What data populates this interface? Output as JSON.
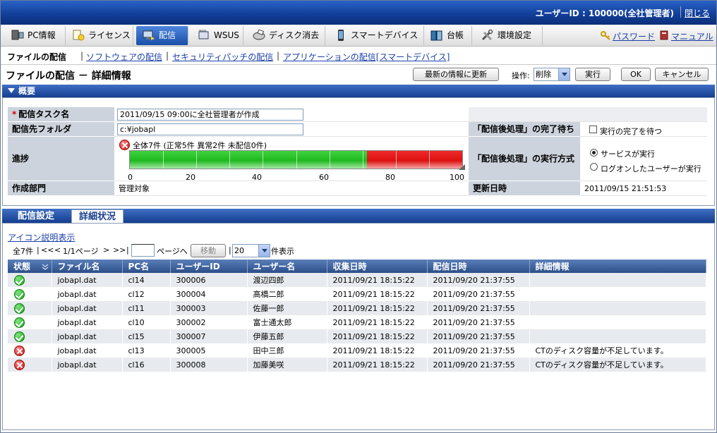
{
  "header": {
    "user_id": "ユーザーID : 100000(全社管理者)",
    "close_label": "閉じる"
  },
  "menu": [
    {
      "label": "PC情報",
      "icon": "pc-icon"
    },
    {
      "label": "ライセンス",
      "icon": "license-icon"
    },
    {
      "label": "配信",
      "icon": "distribution-icon",
      "active": true
    },
    {
      "label": "WSUS",
      "icon": "wsus-icon"
    },
    {
      "label": "ディスク消去",
      "icon": "disk-erase-icon"
    },
    {
      "label": "スマートデバイス",
      "icon": "smart-device-icon"
    },
    {
      "label": "台帳",
      "icon": "ledger-icon"
    },
    {
      "label": "環境設定",
      "icon": "settings-tool-icon"
    }
  ],
  "right_links": {
    "password": "パスワード",
    "manual": "マニュアル"
  },
  "subnav": {
    "current": "ファイルの配信",
    "links": [
      "ソフトウェアの配信",
      "セキュリティパッチの配信",
      "アプリケーションの配信[スマートデバイス]"
    ]
  },
  "page": {
    "title": "ファイルの配信 － 詳細情報",
    "refresh_button": "最新の情報に更新",
    "operation_label": "操作:",
    "operation_value": "削除",
    "execute_button": "実行",
    "ok_button": "OK",
    "cancel_button": "キャンセル"
  },
  "summary": {
    "section_title": "概要",
    "task_name_label": "配信タスク名",
    "task_name_value": "2011/09/15 09:00に全社管理者が作成",
    "folder_label": "配信先フォルダ",
    "folder_value": "c:¥jobapl",
    "progress_label": "進捗",
    "progress_text": "全体7件 (正常5件 異常2件 未配信0件)",
    "progress": {
      "total": 7,
      "ok": 5,
      "error": 2,
      "undelivered": 0
    },
    "ticks": [
      "0",
      "20",
      "40",
      "60",
      "80",
      "100"
    ],
    "dept_label": "作成部門",
    "dept_value": "管理対象",
    "wait_label": "「配信後処理」の完了待ち",
    "wait_option": "実行の完了を待つ",
    "method_label": "「配信後処理」の実行方式",
    "method_options": [
      "サービスが実行",
      "ログオンしたユーザーが実行"
    ],
    "method_selected": 0,
    "updated_label": "更新日時",
    "updated_value": "2011/09/15 21:51:53"
  },
  "tabs": {
    "settings": "配信設定",
    "detail": "詳細状況"
  },
  "detail": {
    "icon_legend": "アイコン説明表示",
    "pager": {
      "total": "全7件",
      "first": "<<",
      "prev": "<",
      "page_info": "1/1ページ",
      "next": ">",
      "last": ">>",
      "goto_label": "ページへ",
      "move_button": "移動",
      "per_page": "20",
      "per_page_label": "件表示"
    },
    "columns": [
      "状態",
      "ファイル名",
      "PC名",
      "ユーザーID",
      "ユーザー名",
      "収集日時",
      "配信日時",
      "詳細情報"
    ],
    "rows": [
      {
        "status": "ok",
        "file": "jobapl.dat",
        "pc": "cl14",
        "uid": "300006",
        "uname": "渡辺四郎",
        "collected": "2011/09/21 18:15:22",
        "delivered": "2011/09/20 21:37:55",
        "detail": ""
      },
      {
        "status": "ok",
        "file": "jobapl.dat",
        "pc": "cl12",
        "uid": "300004",
        "uname": "高橋二郎",
        "collected": "2011/09/21 18:15:22",
        "delivered": "2011/09/20 21:37:55",
        "detail": ""
      },
      {
        "status": "ok",
        "file": "jobapl.dat",
        "pc": "cl11",
        "uid": "300003",
        "uname": "佐藤一郎",
        "collected": "2011/09/21 18:15:22",
        "delivered": "2011/09/20 21:37:55",
        "detail": ""
      },
      {
        "status": "ok",
        "file": "jobapl.dat",
        "pc": "cl10",
        "uid": "300002",
        "uname": "富士通太郎",
        "collected": "2011/09/21 18:15:22",
        "delivered": "2011/09/20 21:37:55",
        "detail": ""
      },
      {
        "status": "ok",
        "file": "jobapl.dat",
        "pc": "cl15",
        "uid": "300007",
        "uname": "伊藤五郎",
        "collected": "2011/09/21 18:15:22",
        "delivered": "2011/09/20 21:37:55",
        "detail": ""
      },
      {
        "status": "error",
        "file": "jobapl.dat",
        "pc": "cl13",
        "uid": "300005",
        "uname": "田中三郎",
        "collected": "2011/09/21 18:15:22",
        "delivered": "2011/09/20 21:37:55",
        "detail": "CTのディスク容量が不足しています。"
      },
      {
        "status": "error",
        "file": "jobapl.dat",
        "pc": "cl16",
        "uid": "300008",
        "uname": "加藤美咲",
        "collected": "2011/09/21 18:15:22",
        "delivered": "2011/09/20 21:37:55",
        "detail": "CTのディスク容量が不足しています。"
      }
    ]
  },
  "colors": {
    "header_blue": "#123f9a",
    "ok_green": "#1fb91f",
    "error_red": "#dd1111",
    "link_blue": "#1a3fa8"
  }
}
